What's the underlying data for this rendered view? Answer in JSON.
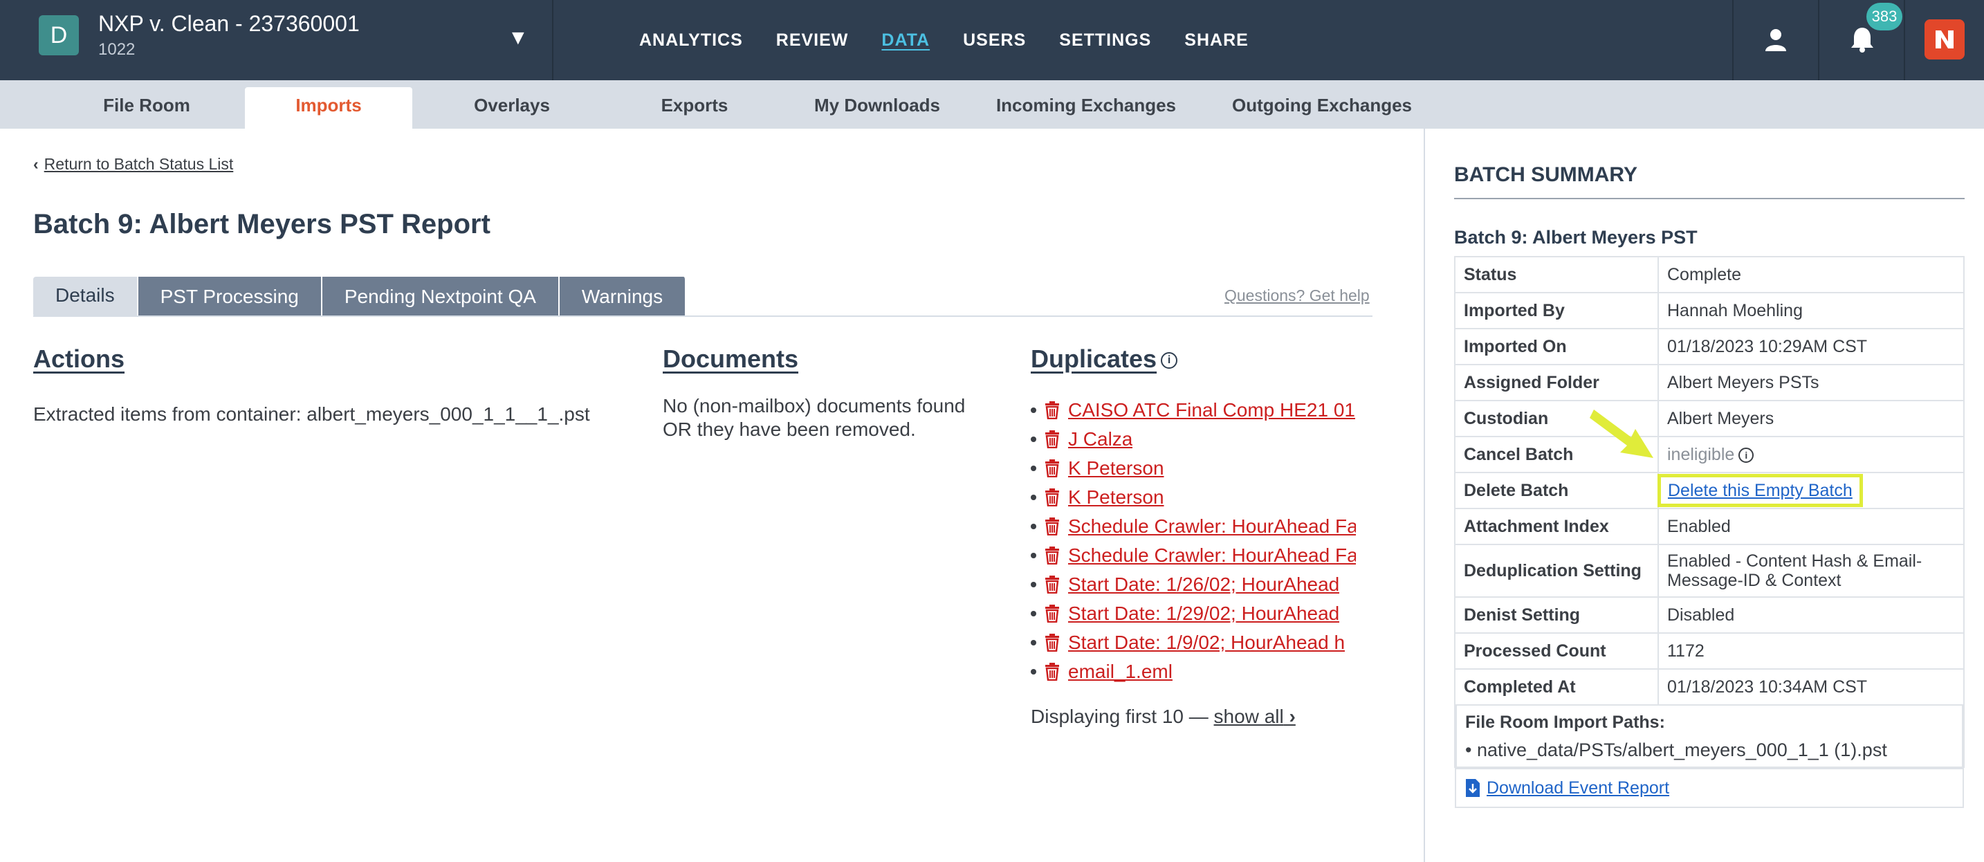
{
  "header": {
    "case_initial": "D",
    "case_title": "NXP v. Clean - 237360001",
    "case_sub": "1022",
    "nav": [
      "ANALYTICS",
      "REVIEW",
      "DATA",
      "USERS",
      "SETTINGS",
      "SHARE"
    ],
    "active_nav": "DATA",
    "notifications": "383"
  },
  "subnav": {
    "tabs": [
      "File Room",
      "Imports",
      "Overlays",
      "Exports",
      "My Downloads",
      "Incoming Exchanges",
      "Outgoing Exchanges"
    ],
    "active": "Imports"
  },
  "main": {
    "back_link": "Return to Batch Status List",
    "title": "Batch 9: Albert Meyers PST Report",
    "tabs": [
      "Details",
      "PST Processing",
      "Pending Nextpoint QA",
      "Warnings"
    ],
    "help_link": "Questions? Get help",
    "actions": {
      "heading": "Actions",
      "text": "Extracted items from container: albert_meyers_000_1_1__1_.pst"
    },
    "documents": {
      "heading": "Documents",
      "text_line1": "No (non-mailbox) documents found",
      "text_line2": "OR they have been removed."
    },
    "duplicates": {
      "heading": "Duplicates",
      "items": [
        "CAISO ATC Final Comp HE21 01",
        "J Calza",
        "K Peterson",
        "K Peterson",
        "Schedule Crawler: HourAhead Fa",
        "Schedule Crawler: HourAhead Fa",
        "Start Date: 1/26/02; HourAhead",
        "Start Date: 1/29/02; HourAhead",
        "Start Date: 1/9/02; HourAhead h",
        "email_1.eml"
      ],
      "footer_prefix": "Displaying first 10 —",
      "footer_link": "show all"
    }
  },
  "sidebar": {
    "heading": "BATCH SUMMARY",
    "subheading": "Batch 9: Albert Meyers PST",
    "rows": {
      "status": {
        "k": "Status",
        "v": "Complete"
      },
      "imported_by": {
        "k": "Imported By",
        "v": "Hannah Moehling"
      },
      "imported_on": {
        "k": "Imported On",
        "v": "01/18/2023 10:29AM CST"
      },
      "assigned_folder": {
        "k": "Assigned Folder",
        "v": "Albert Meyers PSTs"
      },
      "custodian": {
        "k": "Custodian",
        "v": "Albert Meyers"
      },
      "cancel_batch": {
        "k": "Cancel Batch",
        "v": "ineligible"
      },
      "delete_batch": {
        "k": "Delete Batch",
        "v": "Delete this Empty Batch"
      },
      "attachment_index": {
        "k": "Attachment Index",
        "v": "Enabled"
      },
      "dedup": {
        "k": "Deduplication Setting",
        "v": "Enabled - Content Hash & Email-Message-ID & Context"
      },
      "denist": {
        "k": "Denist Setting",
        "v": "Disabled"
      },
      "processed": {
        "k": "Processed Count",
        "v": "1172"
      },
      "completed": {
        "k": "Completed At",
        "v": "01/18/2023 10:34AM CST"
      }
    },
    "paths_heading": "File Room Import Paths:",
    "path_item": "native_data/PSTs/albert_meyers_000_1_1 (1).pst",
    "download_link": "Download Event Report"
  },
  "colors": {
    "topbar": "#2f3e50",
    "accent_nav": "#4cc0e2",
    "active_subtab": "#e35a31",
    "duplicate_link": "#cc1f1f",
    "link_blue": "#1f64c8",
    "highlight": "#e0ec3a"
  }
}
